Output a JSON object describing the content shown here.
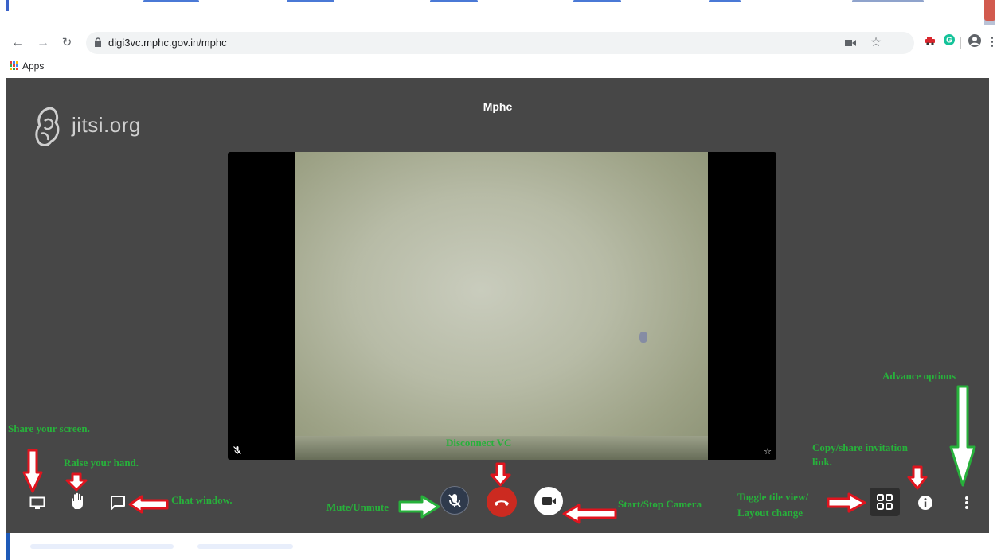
{
  "browser": {
    "url": "digi3vc.mphc.gov.in/mphc",
    "bookmarks_apps_label": "Apps",
    "nav": {
      "back_icon": "arrow-left-icon",
      "forward_icon": "arrow-right-icon",
      "reload_icon": "reload-icon"
    }
  },
  "meeting": {
    "logo_text": "jitsi.org",
    "room_name": "Mphc"
  },
  "annotations": {
    "share_screen": "Share your screen.",
    "raise_hand": "Raise your hand.",
    "chat": "Chat window.",
    "mute": "Mute/Unmute",
    "disconnect": "Disconnect VC",
    "camera": "Start/Stop Camera",
    "tile_line1": "Toggle tile view/",
    "tile_line2": "Layout change",
    "invite_line1": "Copy/share invitation",
    "invite_line2": "link.",
    "advance": "Advance options"
  },
  "colors": {
    "annotation_green": "#27b13b",
    "annotation_red": "#e0141e",
    "meeting_bg": "#474747",
    "hangup_red": "#cc2a20"
  }
}
